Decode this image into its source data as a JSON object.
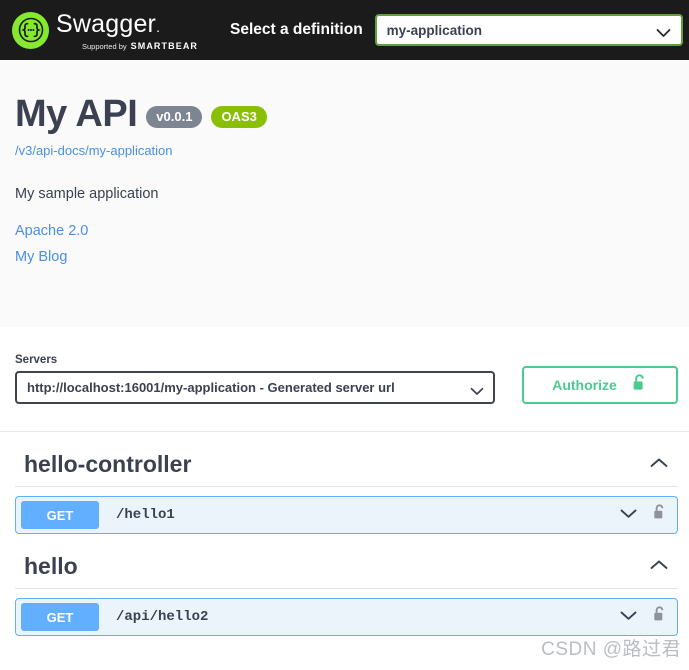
{
  "topbar": {
    "logo_name": "swagger-logo",
    "logo_word": "Swagger",
    "logo_supported_lead": "Supported by",
    "logo_brand": "SMARTBEAR",
    "definition_label": "Select a definition",
    "definition_value": "my-application",
    "definition_chevron": "chevron-down-icon",
    "background": "#1b1b1b",
    "accent": "#85ea2d"
  },
  "info": {
    "title": "My API",
    "version_badge": "v0.0.1",
    "spec_badge": "OAS3",
    "docs_link": "/v3/api-docs/my-application",
    "description": "My sample application",
    "links": [
      {
        "label": "Apache 2.0"
      },
      {
        "label": "My Blog"
      }
    ],
    "link_color": "#4990e2",
    "version_badge_color": "#7d8492",
    "spec_badge_color": "#89bf04"
  },
  "servers": {
    "label": "Servers",
    "selected": "http://localhost:16001/my-application - Generated server url",
    "chevron": "chevron-down-icon"
  },
  "authorize": {
    "label": "Authorize",
    "icon": "unlock-icon",
    "color": "#49cc90"
  },
  "tags": [
    {
      "name": "hello-controller",
      "toggle_icon": "chevron-up-icon",
      "operations": [
        {
          "method": "GET",
          "path": "/hello1",
          "expand_icon": "chevron-down-icon",
          "lock_icon": "unlock-icon",
          "method_color": "#61affe"
        }
      ]
    },
    {
      "name": "hello",
      "toggle_icon": "chevron-up-icon",
      "operations": [
        {
          "method": "GET",
          "path": "/api/hello2",
          "expand_icon": "chevron-down-icon",
          "lock_icon": "unlock-icon",
          "method_color": "#61affe"
        }
      ]
    }
  ],
  "watermark": "CSDN @路过君"
}
